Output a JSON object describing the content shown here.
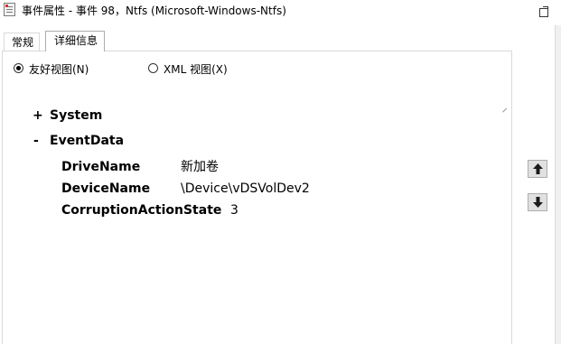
{
  "window": {
    "title": "事件属性 - 事件 98，Ntfs (Microsoft-Windows-Ntfs)"
  },
  "tabs": [
    {
      "label": "常规",
      "active": false
    },
    {
      "label": "详细信息",
      "active": true
    }
  ],
  "view_options": {
    "friendly": {
      "label": "友好视图(N)",
      "selected": true
    },
    "xml": {
      "label": "XML 视图(X)",
      "selected": false
    }
  },
  "tree": {
    "system": {
      "toggle": "+",
      "label": "System"
    },
    "eventdata": {
      "toggle": "-",
      "label": "EventData",
      "fields": [
        {
          "key": "DriveName",
          "value": "新加卷"
        },
        {
          "key": "DeviceName",
          "value": "\\Device\\vDSVolDev2"
        },
        {
          "key": "CorruptionActionState",
          "value": "3"
        }
      ]
    }
  },
  "icons": {
    "app": "event-viewer-icon",
    "restore": "restore-icon",
    "up": "arrow-up-icon",
    "down": "arrow-down-icon"
  },
  "colors": {
    "arrow": "#1a1a1a",
    "button_bg": "#e1e1e1"
  }
}
